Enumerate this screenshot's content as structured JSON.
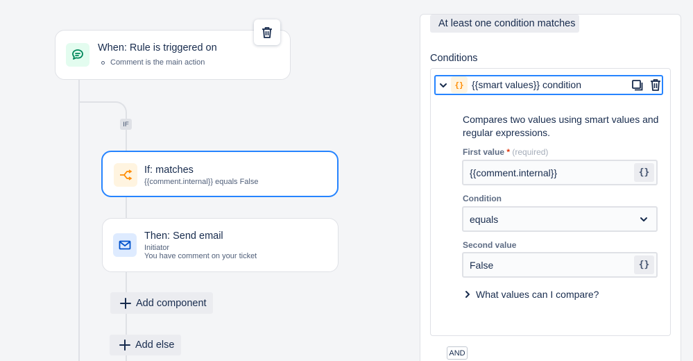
{
  "trigger": {
    "title": "When: Rule is triggered on",
    "detail": "Comment is the main action"
  },
  "branch_badge": "IF",
  "condition_card": {
    "title": "If: matches",
    "detail": "{{comment.internal}} equals False"
  },
  "action_card": {
    "title": "Then: Send email",
    "line1": "Initiator",
    "line2": "You have comment on your ticket"
  },
  "buttons": {
    "add_component": "Add component",
    "add_else": "Add else"
  },
  "panel": {
    "match_mode": "At least one condition matches",
    "conditions_label": "Conditions",
    "condition": {
      "chip": "{}",
      "title": "{{smart values}} condition",
      "description": "Compares two values using smart values and regular expressions.",
      "first_value_label": "First value",
      "required_marker": "*",
      "required_text": "(required)",
      "first_value": "{{comment.internal}}",
      "condition_label": "Condition",
      "condition_value": "equals",
      "second_value_label": "Second value",
      "second_value": "False",
      "smart_value_button": "{}",
      "help_link": "What values can I compare?"
    },
    "and_badge": "AND"
  },
  "colors": {
    "accent": "#2684ff",
    "trigger_icon_bg": "#e3fcef",
    "trigger_icon": "#00875a",
    "condition_icon_bg": "#fff4e0",
    "condition_icon": "#ff8b00",
    "email_icon_bg": "#deebff",
    "email_icon": "#0052cc"
  }
}
